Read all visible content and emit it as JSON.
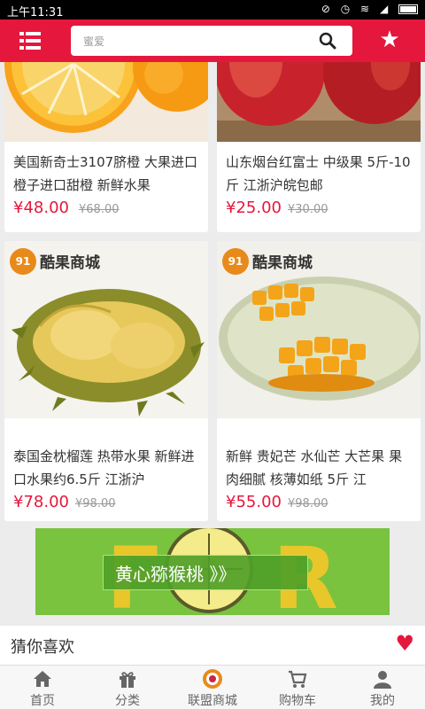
{
  "status_bar": {
    "time": "上午11:31"
  },
  "header": {
    "search_placeholder": "蜜爱"
  },
  "products": [
    {
      "name": "美国新奇士3107脐橙 大果进口橙子进口甜橙 新鲜水果",
      "price": "¥48.00",
      "old_price": "¥68.00",
      "image": "orange"
    },
    {
      "name": "山东烟台红富士 中级果 5斤-10斤 江浙沪皖包邮",
      "price": "¥25.00",
      "old_price": "¥30.00",
      "image": "apple"
    },
    {
      "name": "泰国金枕榴莲 热带水果 新鲜进口水果约6.5斤 江浙沪",
      "price": "¥78.00",
      "old_price": "¥98.00",
      "image": "durian"
    },
    {
      "name": "新鲜 贵妃芒 水仙芒 大芒果 果肉细腻 核薄如纸 5斤 江",
      "price": "¥55.00",
      "old_price": "¥98.00",
      "image": "mango"
    }
  ],
  "brand": {
    "badge": "91",
    "name": "酷果商城"
  },
  "banner": {
    "label": "黄心猕猴桃 》》"
  },
  "recommend": {
    "title": "猜你喜欢"
  },
  "tabs": [
    {
      "label": "首页",
      "icon": "home-icon"
    },
    {
      "label": "分类",
      "icon": "gift-icon"
    },
    {
      "label": "联盟商城",
      "icon": "shop-logo-icon"
    },
    {
      "label": "购物车",
      "icon": "cart-icon"
    },
    {
      "label": "我的",
      "icon": "user-icon"
    }
  ],
  "colors": {
    "brand_red": "#e5173d",
    "price_red": "#e5173d"
  }
}
